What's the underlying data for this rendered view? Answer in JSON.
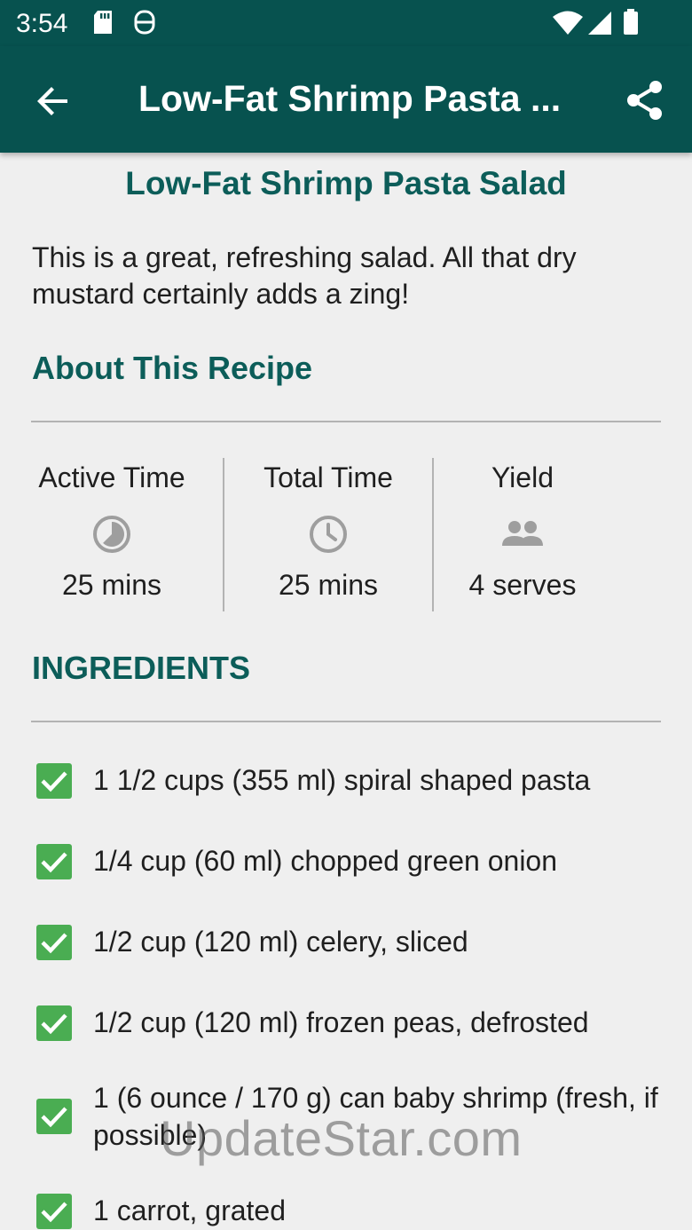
{
  "status_bar": {
    "time": "3:54"
  },
  "app_bar": {
    "title": "Low-Fat Shrimp Pasta ..."
  },
  "recipe": {
    "title": "Low-Fat Shrimp Pasta Salad",
    "description": "This is a great, refreshing salad. All that dry mustard certainly adds a zing!"
  },
  "about": {
    "heading": "About This Recipe",
    "active_time": {
      "label": "Active Time",
      "value": "25 mins",
      "icon": "timer-pie-icon"
    },
    "total_time": {
      "label": "Total Time",
      "value": "25 mins",
      "icon": "clock-icon"
    },
    "yield": {
      "label": "Yield",
      "value": "4 serves",
      "icon": "people-icon"
    }
  },
  "ingredients": {
    "heading": "INGREDIENTS",
    "items": [
      {
        "text": "1 1/2 cups (355 ml) spiral shaped pasta",
        "checked": true
      },
      {
        "text": "1/4 cup (60 ml) chopped green onion",
        "checked": true
      },
      {
        "text": "1/2 cup (120 ml) celery, sliced",
        "checked": true
      },
      {
        "text": "1/2 cup (120 ml) frozen peas, defrosted",
        "checked": true
      },
      {
        "text": "1 (6 ounce / 170 g) can baby shrimp (fresh, if possible)",
        "checked": true
      },
      {
        "text": "1 carrot, grated",
        "checked": true
      }
    ]
  },
  "watermark": "UpdateStar.com",
  "colors": {
    "primary": "#07524f",
    "accent_text": "#0c5d59",
    "checkbox": "#4aad52"
  }
}
